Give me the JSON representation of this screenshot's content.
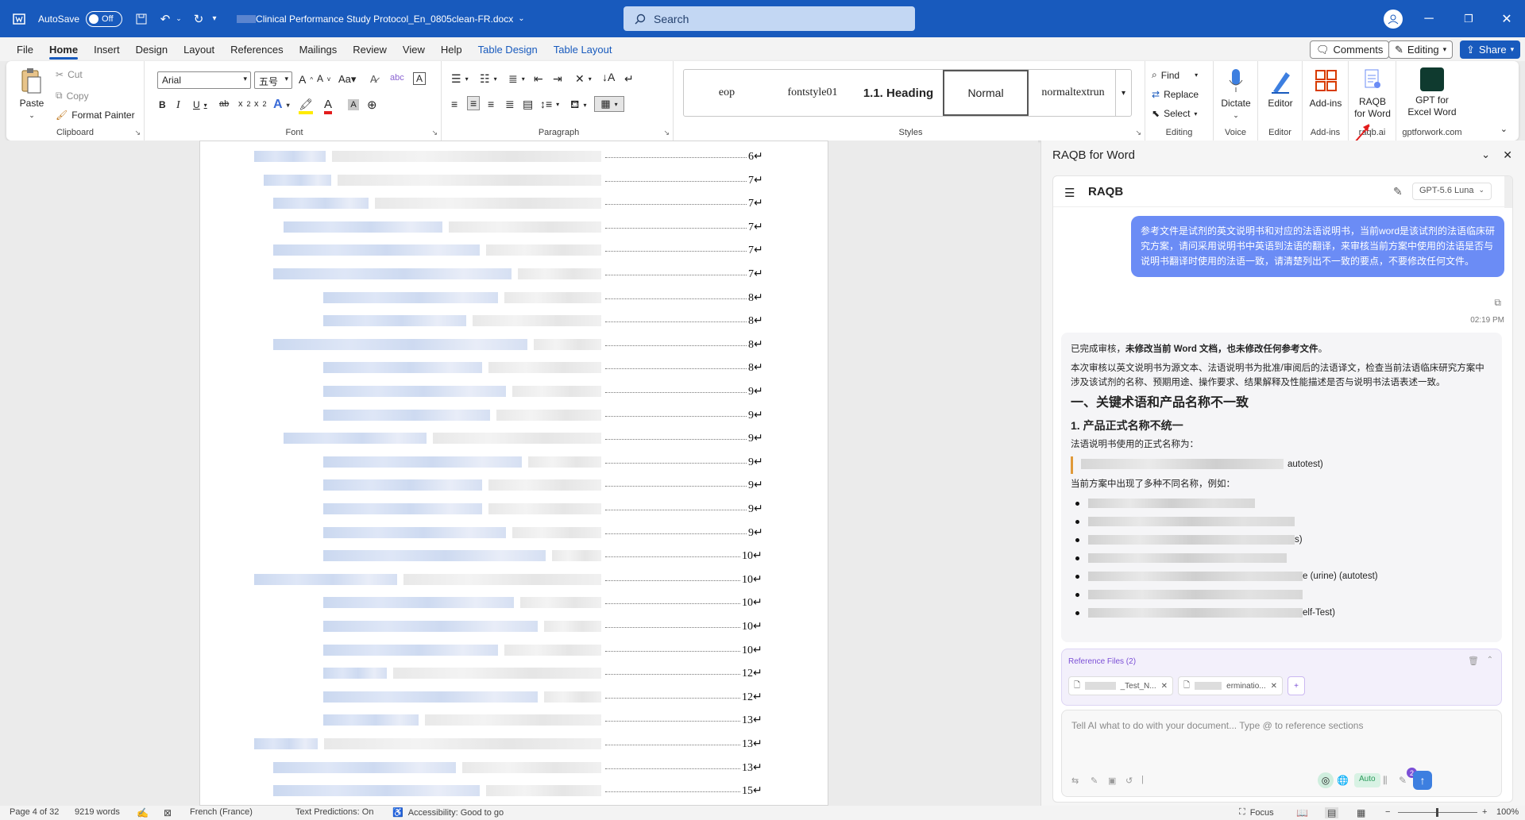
{
  "titlebar": {
    "autosave_label": "AutoSave",
    "autosave_state": "Off",
    "filename": "Clinical Performance Study Protocol_En_0805clean-FR.docx",
    "search_placeholder": "Search"
  },
  "tabs": [
    "File",
    "Home",
    "Insert",
    "Design",
    "Layout",
    "References",
    "Mailings",
    "Review",
    "View",
    "Help",
    "Table Design",
    "Table Layout"
  ],
  "tab_actions": {
    "comments": "Comments",
    "editing": "Editing",
    "share": "Share"
  },
  "ribbon": {
    "clipboard": {
      "paste": "Paste",
      "cut": "Cut",
      "copy": "Copy",
      "format_painter": "Format Painter",
      "label": "Clipboard"
    },
    "font": {
      "name": "Arial",
      "size": "五号",
      "label": "Font"
    },
    "paragraph": {
      "label": "Paragraph"
    },
    "styles": {
      "items": [
        "eop",
        "fontstyle01",
        "1.1.  Heading",
        "Normal",
        "normaltextrun"
      ],
      "label": "Styles"
    },
    "editing": {
      "find": "Find",
      "replace": "Replace",
      "select": "Select",
      "label": "Editing"
    },
    "voice": {
      "dictate": "Dictate",
      "label": "Voice"
    },
    "editor": {
      "editor": "Editor",
      "label": "Editor"
    },
    "addins": {
      "addins": "Add-ins",
      "label": "Add-ins"
    },
    "raqb": {
      "line1": "RAQB",
      "line2": "for Word",
      "label": "raqb.ai"
    },
    "gpt": {
      "line1": "GPT for",
      "line2": "Excel Word",
      "label": "gptforwork.com"
    }
  },
  "toc_page_numbers": [
    "6",
    "7",
    "7",
    "7",
    "7",
    "7",
    "8",
    "8",
    "8",
    "8",
    "9",
    "9",
    "9",
    "9",
    "9",
    "9",
    "9",
    "10",
    "10",
    "10",
    "10",
    "10",
    "12",
    "12",
    "13",
    "13",
    "13",
    "15"
  ],
  "pane": {
    "title": "RAQB for Word",
    "header": "RAQB",
    "model": "GPT-5.6 Luna",
    "user_message": "参考文件是试剂的英文说明书和对应的法语说明书，当前word是该试剂的法语临床研究方案，请问采用说明书中英语到法语的翻译，来审核当前方案中使用的法语是否与说明书翻译时使用的法语一致，请清楚列出不一致的要点，不要修改任何文件。",
    "time": "02:19 PM",
    "ai_p1_a": "已完成审核，",
    "ai_p1_b": "未修改当前 Word 文档，也未修改任何参考文件",
    "ai_p1_c": "。",
    "ai_p2": "本次审核以英文说明书为源文本、法语说明书为批准/审阅后的法语译文，检查当前法语临床研究方案中涉及该试剂的名称、预期用途、操作要求、结果解释及性能描述是否与说明书法语表述一致。",
    "ai_h2": "一、关键术语和产品名称不一致",
    "ai_h3": "1. 产品正式名称不统一",
    "ai_p3": "法语说明书使用的正式名称为：",
    "ai_quote_tail": "autotest)",
    "ai_p4": "当前方案中出现了多种不同名称，例如：",
    "bullet_tails": [
      "",
      "",
      "s)",
      "",
      "e (urine) (autotest)",
      "",
      "elf-Test)"
    ],
    "ref_title": "Reference Files (2)",
    "ref_chips": [
      "_Test_N...",
      "erminatio..."
    ],
    "input_placeholder": "Tell AI what to do with your document... Type @ to reference sections",
    "auto": "Auto",
    "badge": "2"
  },
  "statusbar": {
    "page": "Page 4 of 32",
    "words": "9219 words",
    "language": "French (France)",
    "predictions": "Text Predictions: On",
    "accessibility": "Accessibility: Good to go",
    "focus": "Focus",
    "zoom": "100%"
  }
}
